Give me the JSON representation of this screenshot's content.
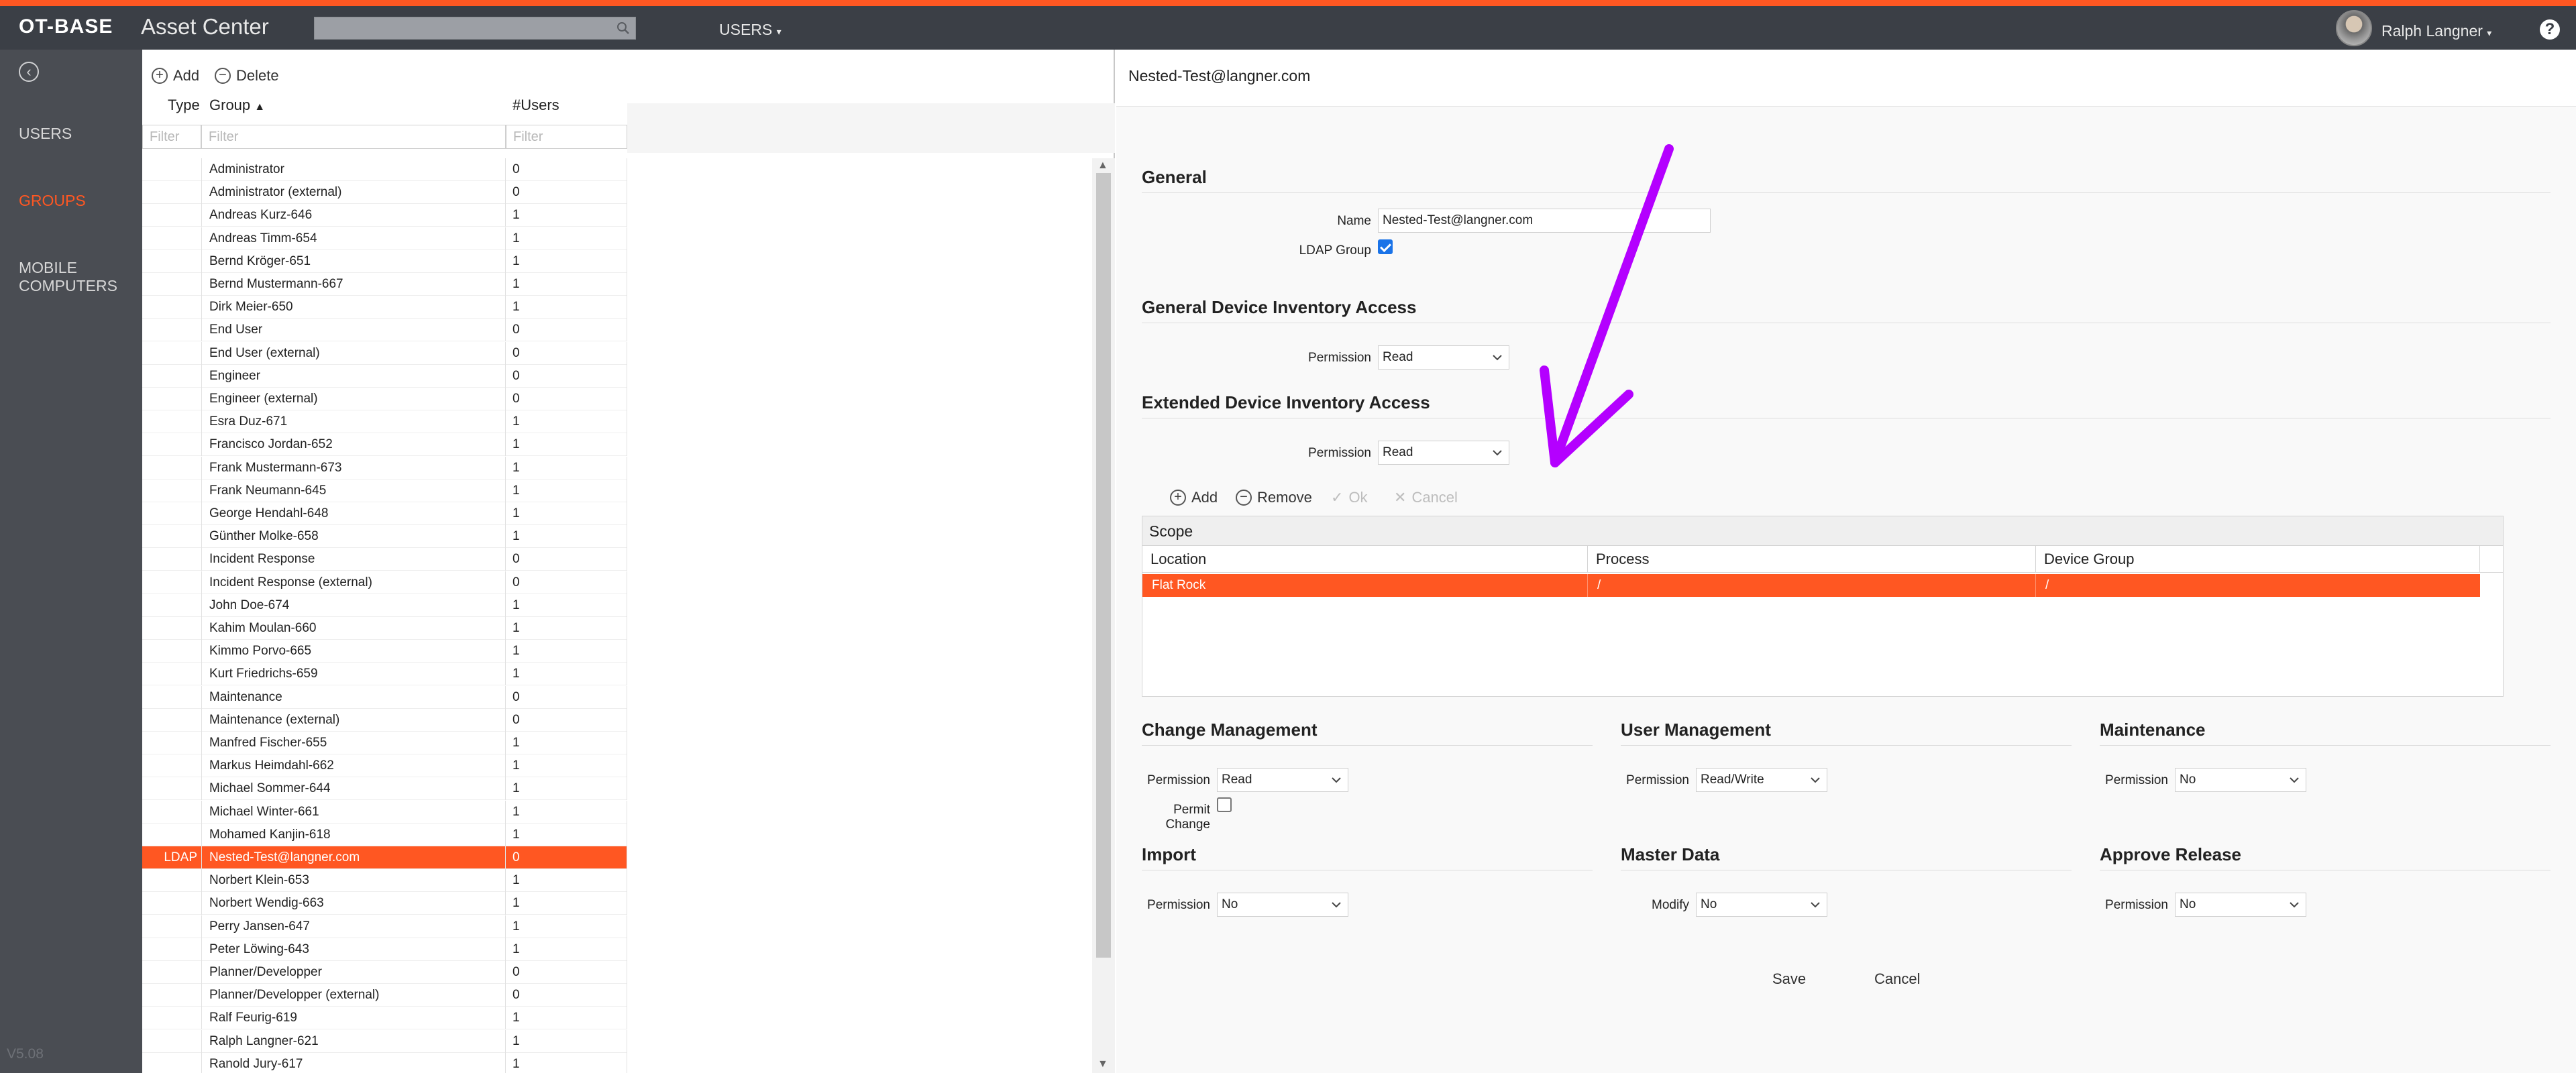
{
  "header": {
    "logo": "OT-BASE",
    "app_name": "Asset Center",
    "search_placeholder": "",
    "users_menu": "USERS",
    "user_name": "Ralph Langner",
    "help": "?"
  },
  "sidebar": {
    "items": [
      {
        "label": "USERS",
        "active": false
      },
      {
        "label": "GROUPS",
        "active": true
      },
      {
        "label": "MOBILE\nCOMPUTERS",
        "line1": "MOBILE",
        "line2": "COMPUTERS",
        "active": false
      }
    ],
    "version": "V5.08"
  },
  "group_list": {
    "add_label": "Add",
    "delete_label": "Delete",
    "columns": {
      "type": "Type",
      "group": "Group",
      "users": "#Users"
    },
    "filter_placeholder": "Filter",
    "rows": [
      {
        "type": "",
        "group": "Administrator",
        "users": "0"
      },
      {
        "type": "",
        "group": "Administrator (external)",
        "users": "0"
      },
      {
        "type": "",
        "group": "Andreas Kurz-646",
        "users": "1"
      },
      {
        "type": "",
        "group": "Andreas Timm-654",
        "users": "1"
      },
      {
        "type": "",
        "group": "Bernd Kröger-651",
        "users": "1"
      },
      {
        "type": "",
        "group": "Bernd Mustermann-667",
        "users": "1"
      },
      {
        "type": "",
        "group": "Dirk Meier-650",
        "users": "1"
      },
      {
        "type": "",
        "group": "End User",
        "users": "0"
      },
      {
        "type": "",
        "group": "End User (external)",
        "users": "0"
      },
      {
        "type": "",
        "group": "Engineer",
        "users": "0"
      },
      {
        "type": "",
        "group": "Engineer (external)",
        "users": "0"
      },
      {
        "type": "",
        "group": "Esra Duz-671",
        "users": "1"
      },
      {
        "type": "",
        "group": "Francisco Jordan-652",
        "users": "1"
      },
      {
        "type": "",
        "group": "Frank Mustermann-673",
        "users": "1"
      },
      {
        "type": "",
        "group": "Frank Neumann-645",
        "users": "1"
      },
      {
        "type": "",
        "group": "George Hendahl-648",
        "users": "1"
      },
      {
        "type": "",
        "group": "Günther Molke-658",
        "users": "1"
      },
      {
        "type": "",
        "group": "Incident Response",
        "users": "0"
      },
      {
        "type": "",
        "group": "Incident Response (external)",
        "users": "0"
      },
      {
        "type": "",
        "group": "John Doe-674",
        "users": "1"
      },
      {
        "type": "",
        "group": "Kahim Moulan-660",
        "users": "1"
      },
      {
        "type": "",
        "group": "Kimmo Porvo-665",
        "users": "1"
      },
      {
        "type": "",
        "group": "Kurt Friedrichs-659",
        "users": "1"
      },
      {
        "type": "",
        "group": "Maintenance",
        "users": "0"
      },
      {
        "type": "",
        "group": "Maintenance (external)",
        "users": "0"
      },
      {
        "type": "",
        "group": "Manfred Fischer-655",
        "users": "1"
      },
      {
        "type": "",
        "group": "Markus Heimdahl-662",
        "users": "1"
      },
      {
        "type": "",
        "group": "Michael Sommer-644",
        "users": "1"
      },
      {
        "type": "",
        "group": "Michael Winter-661",
        "users": "1"
      },
      {
        "type": "",
        "group": "Mohamed Kanjin-618",
        "users": "1"
      },
      {
        "type": "LDAP",
        "group": "Nested-Test@langner.com",
        "users": "0",
        "selected": true
      },
      {
        "type": "",
        "group": "Norbert Klein-653",
        "users": "1"
      },
      {
        "type": "",
        "group": "Norbert Wendig-663",
        "users": "1"
      },
      {
        "type": "",
        "group": "Perry Jansen-647",
        "users": "1"
      },
      {
        "type": "",
        "group": "Peter Löwing-643",
        "users": "1"
      },
      {
        "type": "",
        "group": "Planner/Developper",
        "users": "0"
      },
      {
        "type": "",
        "group": "Planner/Developper (external)",
        "users": "0"
      },
      {
        "type": "",
        "group": "Ralf Feurig-619",
        "users": "1"
      },
      {
        "type": "",
        "group": "Ralph Langner-621",
        "users": "1"
      },
      {
        "type": "",
        "group": "Ranold Jury-617",
        "users": "1"
      }
    ]
  },
  "detail": {
    "title": "Nested-Test@langner.com",
    "general": {
      "heading": "General",
      "name_label": "Name",
      "name_value": "Nested-Test@langner.com",
      "ldap_label": "LDAP Group",
      "ldap_checked": true
    },
    "general_inventory": {
      "heading": "General Device Inventory Access",
      "permission_label": "Permission",
      "permission_value": "Read"
    },
    "extended_inventory": {
      "heading": "Extended Device Inventory Access",
      "permission_label": "Permission",
      "permission_value": "Read"
    },
    "scope_toolbar": {
      "add": "Add",
      "remove": "Remove",
      "ok": "Ok",
      "cancel": "Cancel"
    },
    "scope": {
      "heading": "Scope",
      "columns": [
        "Location",
        "Process",
        "Device Group"
      ],
      "rows": [
        {
          "location": "Flat Rock",
          "process": "/",
          "device_group": "/"
        }
      ]
    },
    "change_management": {
      "heading": "Change Management",
      "permission_label": "Permission",
      "permission_value": "Read",
      "permit_change_label": "Permit Change",
      "permit_change_checked": false
    },
    "user_management": {
      "heading": "User Management",
      "permission_label": "Permission",
      "permission_value": "Read/Write"
    },
    "maintenance": {
      "heading": "Maintenance",
      "permission_label": "Permission",
      "permission_value": "No"
    },
    "import": {
      "heading": "Import",
      "permission_label": "Permission",
      "permission_value": "No"
    },
    "master_data": {
      "heading": "Master Data",
      "modify_label": "Modify",
      "modify_value": "No"
    },
    "approve_release": {
      "heading": "Approve Release",
      "permission_label": "Permission",
      "permission_value": "No"
    },
    "save_label": "Save",
    "cancel_label": "Cancel"
  },
  "annotation": {
    "arrow_color": "#b400ff"
  },
  "colors": {
    "accent": "#ff5722",
    "topbar": "#3b3f46",
    "sidebar": "#4a4d53"
  }
}
